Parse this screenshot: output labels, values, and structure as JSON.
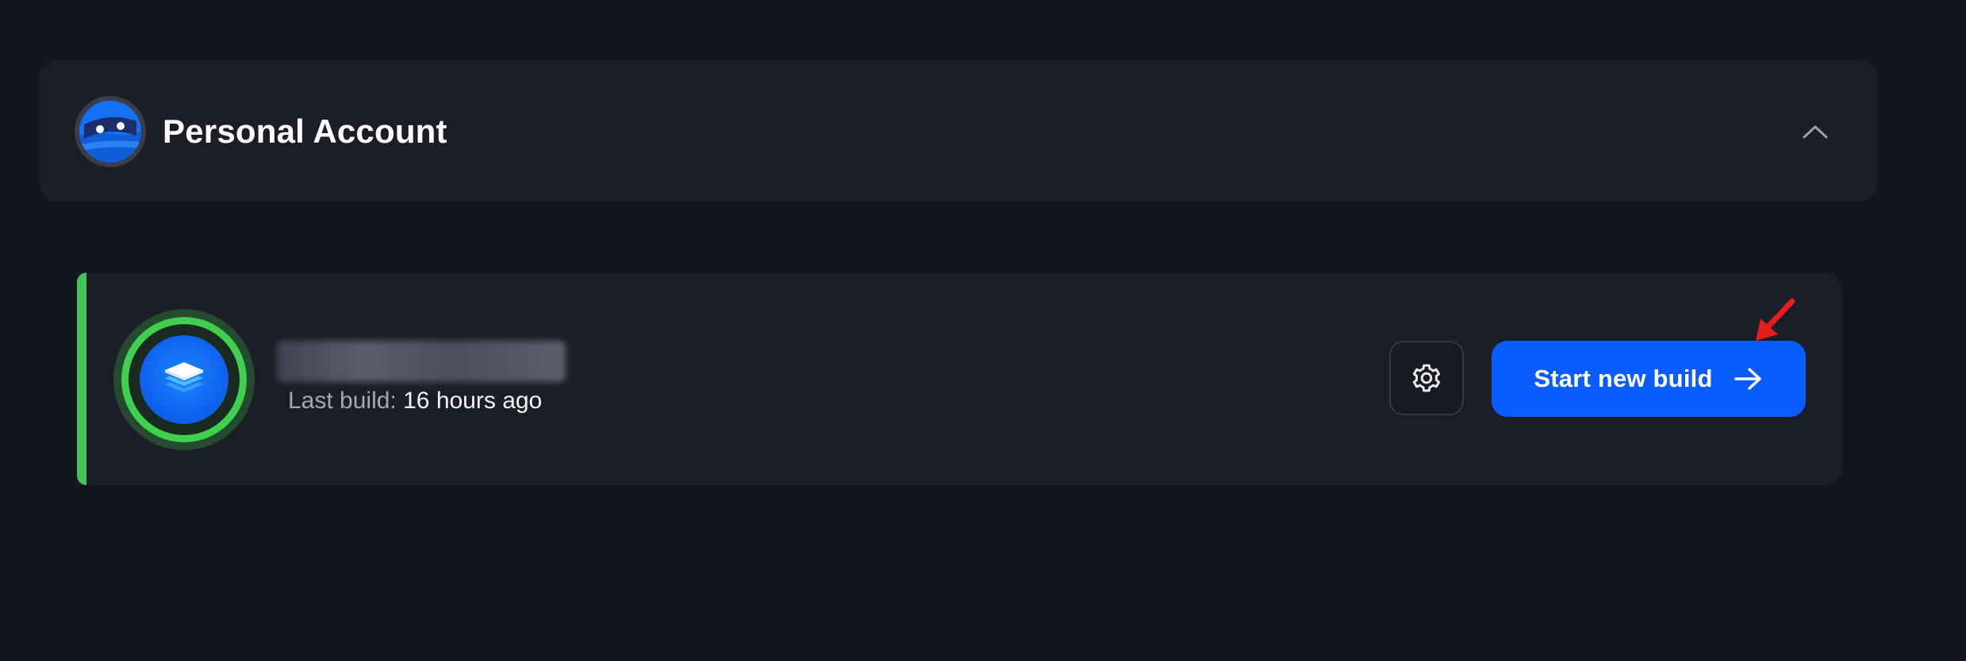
{
  "account": {
    "title": "Personal Account",
    "avatar_icon": "robot-face-icon",
    "collapse_icon": "chevron-up-icon"
  },
  "project": {
    "name": "project-name",
    "name_redacted": true,
    "last_build_label": "Last build:",
    "last_build_value": "16 hours ago",
    "status": "success",
    "icon": "layers-stack-icon",
    "settings_icon": "gear-icon",
    "start_build_label": "Start new build",
    "start_build_icon": "arrow-right-icon"
  },
  "annotation": {
    "type": "red-arrow",
    "color": "#e41d1d"
  },
  "colors": {
    "background": "#13151c",
    "card": "#1b1e26",
    "accent_blue": "#0b5cff",
    "status_green": "#40c659",
    "text_primary": "#ffffff",
    "text_secondary": "#a3a8b3"
  }
}
